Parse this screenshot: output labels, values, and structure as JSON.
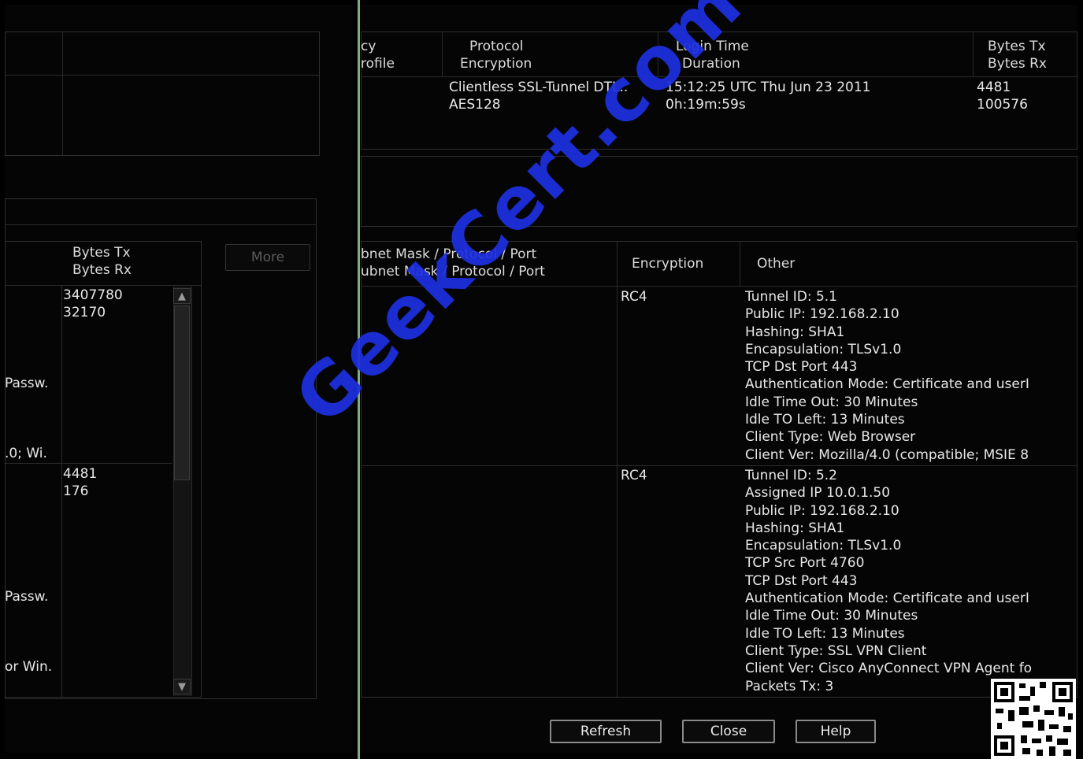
{
  "left_panel": {
    "session_col_headers": [
      "",
      ""
    ],
    "details_headers": {
      "bytes": [
        "Bytes Tx",
        "Bytes Rx"
      ],
      "more_button": "More"
    },
    "rows": [
      {
        "bytes": [
          "3407780",
          "32170"
        ],
        "auth": "Passw.",
        "client": ".0; Wi."
      },
      {
        "bytes": [
          "4481",
          "176"
        ],
        "auth": "Passw.",
        "client": "or Win."
      }
    ]
  },
  "right_panel": {
    "session_headers": {
      "policy": [
        "cy",
        "rofile"
      ],
      "protocol": [
        "Protocol",
        "Encryption"
      ],
      "login": [
        "Login Time",
        "Duration"
      ],
      "bytes": [
        "Bytes Tx",
        "Bytes Rx"
      ]
    },
    "session_row": {
      "protocol": [
        "Clientless SSL-Tunnel DTL..",
        "AES128"
      ],
      "login": [
        "15:12:25 UTC Thu Jun 23 2011",
        "0h:19m:59s"
      ],
      "bytes": [
        "4481",
        "100576"
      ]
    },
    "details_headers": {
      "subnet": [
        "bnet Mask / Protocol / Port",
        "ubnet Mask / Protocol / Port"
      ],
      "encryption": "Encryption",
      "other": "Other"
    },
    "details_rows": [
      {
        "encryption": "RC4",
        "other": [
          "Tunnel ID: 5.1",
          "Public IP: 192.168.2.10",
          "Hashing: SHA1",
          "Encapsulation: TLSv1.0",
          "TCP Dst Port 443",
          "Authentication Mode: Certificate and userI",
          "Idle Time Out: 30 Minutes",
          "Idle TO Left: 13 Minutes",
          "Client Type: Web Browser",
          "Client Ver: Mozilla/4.0 (compatible; MSIE 8"
        ]
      },
      {
        "encryption": "RC4",
        "other": [
          "Tunnel ID: 5.2",
          "Assigned IP 10.0.1.50",
          "Public IP: 192.168.2.10",
          "Hashing: SHA1",
          "Encapsulation: TLSv1.0",
          "TCP Src Port 4760",
          "TCP Dst Port 443",
          "Authentication Mode: Certificate and userI",
          "Idle Time Out: 30 Minutes",
          "Idle TO Left: 13 Minutes",
          "Client Type: SSL VPN Client",
          "Client Ver: Cisco AnyConnect VPN Agent fo",
          "Packets Tx: 3"
        ]
      }
    ],
    "buttons": {
      "refresh": "Refresh",
      "close": "Close",
      "help": "Help"
    }
  },
  "watermark": "GeekCert.com",
  "colors": {
    "background": "#000000",
    "watermark": "#1d2fe0",
    "divider": "#7fae7f"
  }
}
